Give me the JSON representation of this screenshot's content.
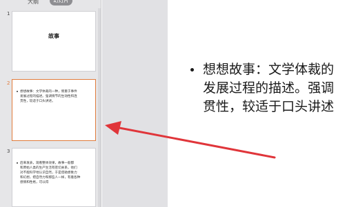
{
  "panel": {
    "tabs": [
      {
        "label": "大纲"
      },
      {
        "label": "幻灯片"
      }
    ]
  },
  "slides": [
    {
      "number": "1",
      "title": "故事"
    },
    {
      "number": "2",
      "lines": [
        "想想故事：文学体裁的一种，侧重于事件",
        "发展过程的描述。强调情节的生动性和连",
        "贯性，较适于口头讲述。"
      ]
    },
    {
      "number": "3",
      "lines": [
        "后来发表，观看整体效果，故事一般都",
        "和原始人类的生产生活有密切关系，他们",
        "对不能科学地认识自然，于是借助想象力",
        "和幻想，把自然力和那些人一样，有着各种",
        "感情和性格，可以得"
      ]
    }
  ],
  "main": {
    "lines": [
      "想想故事：文学体裁的",
      "发展过程的描述。强调",
      "贯性，较适于口头讲述"
    ]
  },
  "colors": {
    "selection": "#e07a3a",
    "arrow": "#e0353a"
  }
}
